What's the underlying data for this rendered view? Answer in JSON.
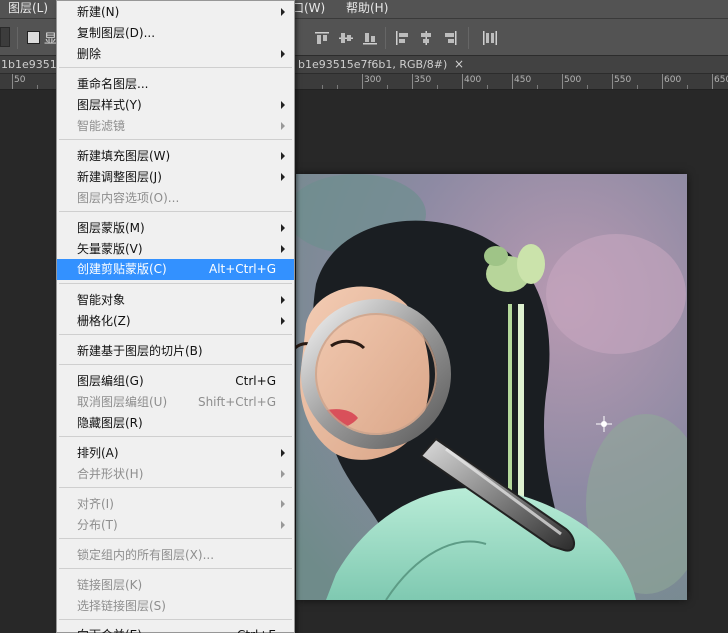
{
  "menubar": {
    "layer_menu": "图层(L)",
    "window_menu": "口(W)",
    "help_menu": "帮助(H)"
  },
  "options_bar": {
    "checkbox_label": "显"
  },
  "tabs": {
    "tab1": "1b1e9351",
    "tab2": "b1e93515e7f6b1, RGB/8#) *",
    "close": "×"
  },
  "ruler": {
    "labels": [
      "50",
      "300",
      "350",
      "400",
      "450",
      "500",
      "550",
      "600",
      "650"
    ]
  },
  "menu": {
    "items": [
      {
        "label": "新建(N)",
        "shortcut": "",
        "submenu": true,
        "disabled": false
      },
      {
        "label": "复制图层(D)...",
        "shortcut": "",
        "submenu": false,
        "disabled": false
      },
      {
        "label": "删除",
        "shortcut": "",
        "submenu": true,
        "disabled": false
      },
      {
        "label": "重命名图层...",
        "shortcut": "",
        "submenu": false,
        "disabled": false
      },
      {
        "label": "图层样式(Y)",
        "shortcut": "",
        "submenu": true,
        "disabled": false
      },
      {
        "label": "智能滤镜",
        "shortcut": "",
        "submenu": true,
        "disabled": true
      },
      {
        "label": "新建填充图层(W)",
        "shortcut": "",
        "submenu": true,
        "disabled": false
      },
      {
        "label": "新建调整图层(J)",
        "shortcut": "",
        "submenu": true,
        "disabled": false
      },
      {
        "label": "图层内容选项(O)...",
        "shortcut": "",
        "submenu": false,
        "disabled": true
      },
      {
        "label": "图层蒙版(M)",
        "shortcut": "",
        "submenu": true,
        "disabled": false
      },
      {
        "label": "矢量蒙版(V)",
        "shortcut": "",
        "submenu": true,
        "disabled": false
      },
      {
        "label": "创建剪贴蒙版(C)",
        "shortcut": "Alt+Ctrl+G",
        "submenu": false,
        "disabled": false,
        "highlighted": true
      },
      {
        "label": "智能对象",
        "shortcut": "",
        "submenu": true,
        "disabled": false
      },
      {
        "label": "栅格化(Z)",
        "shortcut": "",
        "submenu": true,
        "disabled": false
      },
      {
        "label": "新建基于图层的切片(B)",
        "shortcut": "",
        "submenu": false,
        "disabled": false
      },
      {
        "label": "图层编组(G)",
        "shortcut": "Ctrl+G",
        "submenu": false,
        "disabled": false
      },
      {
        "label": "取消图层编组(U)",
        "shortcut": "Shift+Ctrl+G",
        "submenu": false,
        "disabled": true
      },
      {
        "label": "隐藏图层(R)",
        "shortcut": "",
        "submenu": false,
        "disabled": false
      },
      {
        "label": "排列(A)",
        "shortcut": "",
        "submenu": true,
        "disabled": false
      },
      {
        "label": "合并形状(H)",
        "shortcut": "",
        "submenu": true,
        "disabled": true
      },
      {
        "label": "对齐(I)",
        "shortcut": "",
        "submenu": true,
        "disabled": true
      },
      {
        "label": "分布(T)",
        "shortcut": "",
        "submenu": true,
        "disabled": true
      },
      {
        "label": "锁定组内的所有图层(X)...",
        "shortcut": "",
        "submenu": false,
        "disabled": true
      },
      {
        "label": "链接图层(K)",
        "shortcut": "",
        "submenu": false,
        "disabled": true
      },
      {
        "label": "选择链接图层(S)",
        "shortcut": "",
        "submenu": false,
        "disabled": true
      },
      {
        "label": "向下合并(E)",
        "shortcut": "Ctrl+E",
        "submenu": false,
        "disabled": false
      }
    ]
  },
  "colors": {
    "menu_highlight": "#3391ff",
    "workspace_bg": "#282828",
    "panel_bg": "#535353"
  }
}
